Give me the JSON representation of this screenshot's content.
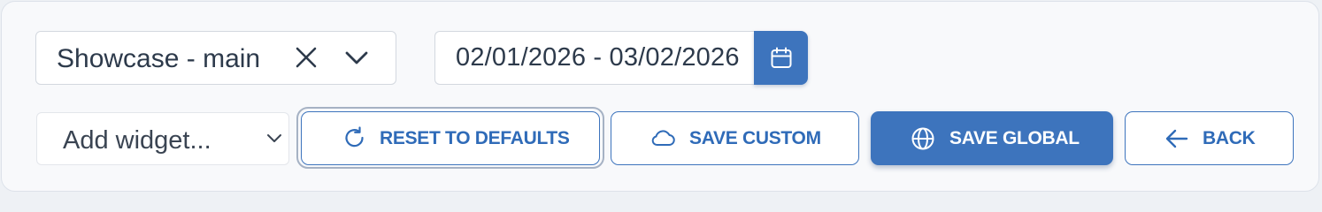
{
  "filters": {
    "dashboard_select": {
      "value": "Showcase - main"
    },
    "date_range": {
      "value": "02/01/2026 - 03/02/2026"
    }
  },
  "toolbar": {
    "add_widget_placeholder": "Add widget...",
    "reset_label": "RESET TO DEFAULTS",
    "save_custom_label": "SAVE CUSTOM",
    "save_global_label": "SAVE GLOBAL",
    "back_label": "BACK"
  },
  "icons": {
    "clear": "close-icon",
    "dropdown": "chevron-down-icon",
    "calendar": "calendar-icon",
    "reset": "rotate-cw-icon",
    "save_custom": "cloud-icon",
    "save_global": "globe-icon",
    "back": "arrow-left-icon"
  },
  "colors": {
    "primary": "#3d74bd",
    "primary_text": "#2f6bb8",
    "text": "#2d3a4b",
    "border": "#d3d8df",
    "focus_ring": "#a6b2c4"
  }
}
